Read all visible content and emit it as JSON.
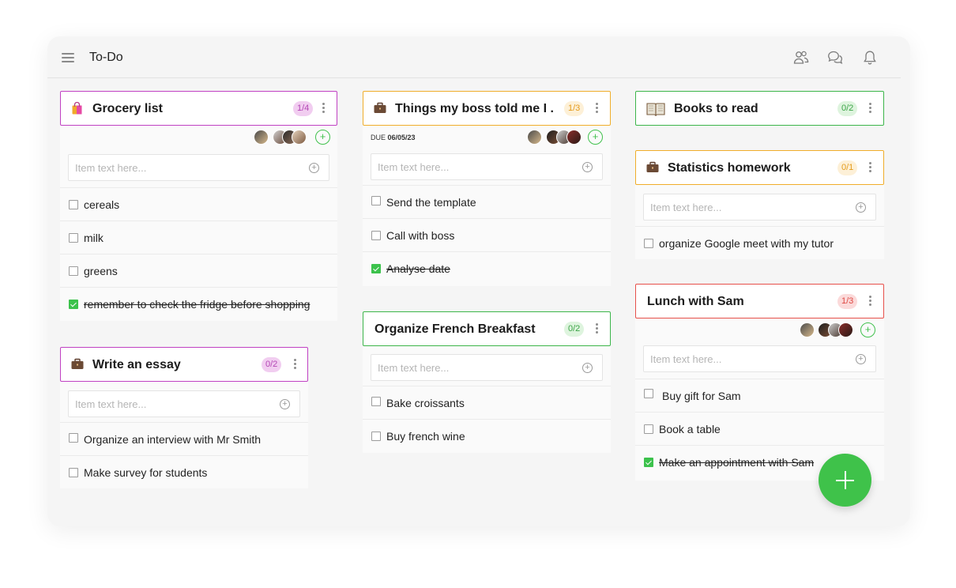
{
  "app": {
    "title": "To-Do"
  },
  "header_icons": [
    "users-icon",
    "chat-icon",
    "bell-icon"
  ],
  "input_placeholder": "Item text here...",
  "colors": {
    "purple": "#c041c3",
    "orange": "#f0ad2a",
    "green": "#3cb54a",
    "red": "#e6504a",
    "check_green": "#3cc24c",
    "fab_green": "#3fc24a"
  },
  "cards": {
    "grocery": {
      "title": "Grocery list",
      "icon": "shopping-bag-icon",
      "count": "1/4",
      "items": [
        {
          "text": "cereals",
          "done": false
        },
        {
          "text": "milk",
          "done": false
        },
        {
          "text": "greens",
          "done": false
        },
        {
          "text": "remember to check the fridge before shopping",
          "done": true
        }
      ]
    },
    "essay": {
      "title": "Write an essay",
      "icon": "briefcase-icon",
      "count": "0/2",
      "items": [
        {
          "text": "Organize an interview with Mr Smith",
          "done": false
        },
        {
          "text": "Make survey for students",
          "done": false
        }
      ]
    },
    "boss": {
      "title": "Things my boss told me I ...",
      "icon": "briefcase-icon",
      "count": "1/3",
      "due_label": "DUE",
      "due_date": "06/05/23",
      "items": [
        {
          "text": "Send the template",
          "done": false
        },
        {
          "text": "Call with boss",
          "done": false
        },
        {
          "text": "Analyse date",
          "done": true
        }
      ]
    },
    "french": {
      "title": "Organize French Breakfast",
      "count": "0/2",
      "items": [
        {
          "text": "Bake croissants",
          "done": false
        },
        {
          "text": "Buy french wine",
          "done": false
        }
      ]
    },
    "books": {
      "title": "Books to read",
      "icon": "book-icon",
      "count": "0/2"
    },
    "stats": {
      "title": "Statistics homework",
      "icon": "briefcase-icon",
      "count": "0/1",
      "items": [
        {
          "text": "organize Google meet with my tutor",
          "done": false
        }
      ]
    },
    "lunch": {
      "title": "Lunch with Sam",
      "count": "1/3",
      "items": [
        {
          "text": "Buy gift for Sam",
          "done": false
        },
        {
          "text": "Book a table",
          "done": false
        },
        {
          "text": "Make an appointment with Sam",
          "done": true
        }
      ]
    }
  }
}
